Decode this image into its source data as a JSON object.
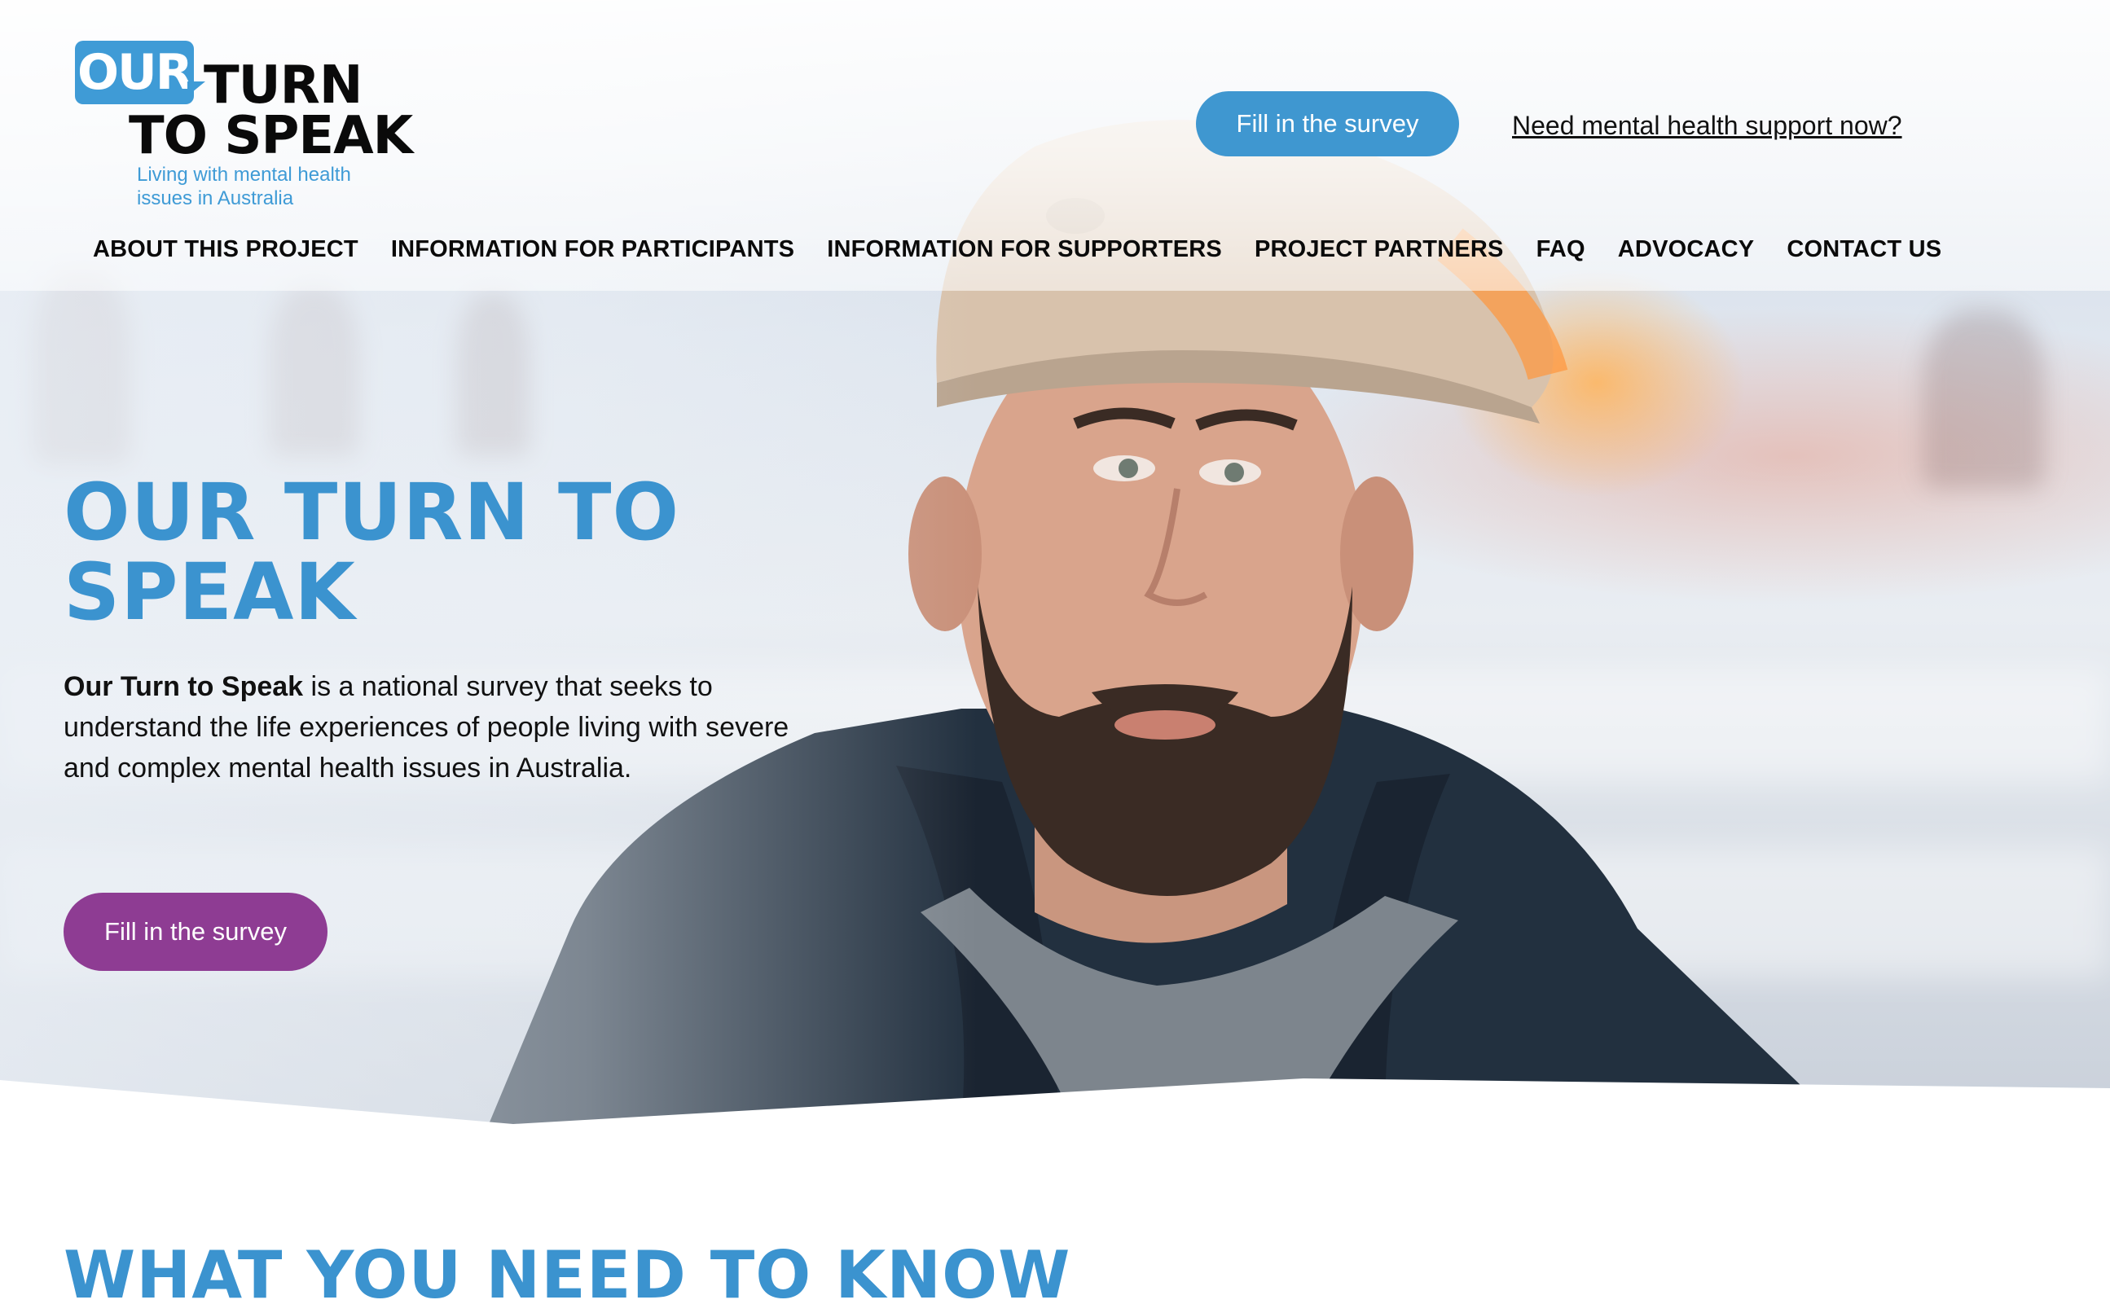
{
  "logo": {
    "word_our": "OUR",
    "word_turn": "TURN",
    "word_to_speak": "TO SPEAK",
    "tagline_line1": "Living with mental health",
    "tagline_line2": "issues in Australia"
  },
  "header": {
    "survey_button": "Fill in the survey",
    "support_link": "Need mental health support now?"
  },
  "nav": {
    "items": [
      {
        "label": "ABOUT THIS PROJECT"
      },
      {
        "label": "INFORMATION FOR PARTICIPANTS"
      },
      {
        "label": "INFORMATION FOR SUPPORTERS"
      },
      {
        "label": "PROJECT PARTNERS"
      },
      {
        "label": "FAQ"
      },
      {
        "label": "ADVOCACY"
      },
      {
        "label": "CONTACT US"
      }
    ]
  },
  "hero": {
    "title_line1": "OUR TURN TO",
    "title_line2": "SPEAK",
    "desc_bold": "Our Turn to Speak",
    "desc_rest": " is a national survey that seeks to understand the life experiences of people living with severe and complex mental health issues in Australia.",
    "survey_button": "Fill in the survey",
    "image_subject": "portrait-photo-man-in-cap"
  },
  "section": {
    "title": "WHAT YOU NEED TO KNOW"
  },
  "colors": {
    "brand_blue": "#3f97d0",
    "brand_purple": "#8e3c93",
    "text_dark": "#111111"
  }
}
